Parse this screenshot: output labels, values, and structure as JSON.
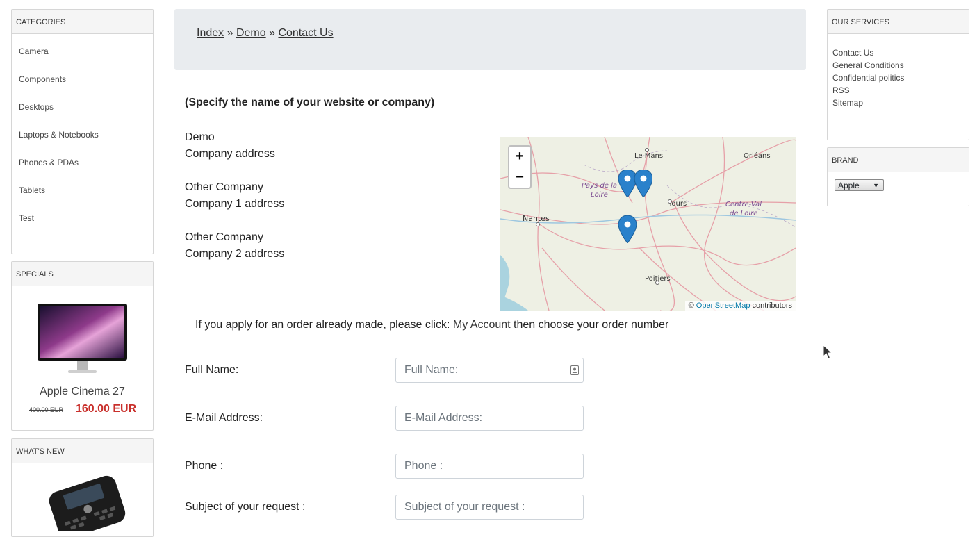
{
  "categories": {
    "title": "CATEGORIES",
    "items": [
      "Camera",
      "Components",
      "Desktops",
      "Laptops & Notebooks",
      "Phones & PDAs",
      "Tablets",
      "Test"
    ]
  },
  "specials": {
    "title": "SPECIALS",
    "product_name": "Apple Cinema 27",
    "old_price": "400.00 EUR",
    "price": "160.00 EUR"
  },
  "whats_new": {
    "title": "WHAT'S NEW"
  },
  "breadcrumb": {
    "index": "Index",
    "sep": "»",
    "demo": "Demo",
    "current": "Contact Us"
  },
  "company": {
    "heading": "(Specify the name of your website or company)",
    "name1": "Demo",
    "addr1": "Company address",
    "name2": "Other Company",
    "addr2": "Company 1 address",
    "name3": "Other Company",
    "addr3": "Company 2 address"
  },
  "map": {
    "zoom_in": "+",
    "zoom_out": "−",
    "attrib_prefix": "©",
    "attrib_link": "OpenStreetMap",
    "attrib_suffix": "contributors",
    "labels": {
      "le_mans": "Le Mans",
      "orleans": "Orléans",
      "pays_loire": "Pays de la",
      "pays_loire2": "Loire",
      "tours": "Tours",
      "centre": "Centre-Val",
      "centre2": "de Loire",
      "nantes": "Nantes",
      "poitiers": "Poitiers"
    }
  },
  "order_note": {
    "before": "If you apply for an order already made, please click:",
    "link": "My Account",
    "after": "then choose your order number"
  },
  "form": {
    "full_name_label": "Full Name:",
    "full_name_placeholder": "Full Name:",
    "email_label": "E-Mail Address:",
    "email_placeholder": "E-Mail Address:",
    "phone_label": "Phone :",
    "phone_placeholder": "Phone :",
    "subject_label": "Subject of your request :",
    "subject_placeholder": "Subject of your request :"
  },
  "services": {
    "title": "OUR SERVICES",
    "items": [
      "Contact Us",
      "General Conditions",
      "Confidential politics",
      "RSS",
      "Sitemap"
    ]
  },
  "brand": {
    "title": "BRAND",
    "selected": "Apple"
  },
  "colors": {
    "price_red": "#c9302c",
    "link_blue": "#0078a8",
    "marker_blue": "#2a81cb"
  }
}
